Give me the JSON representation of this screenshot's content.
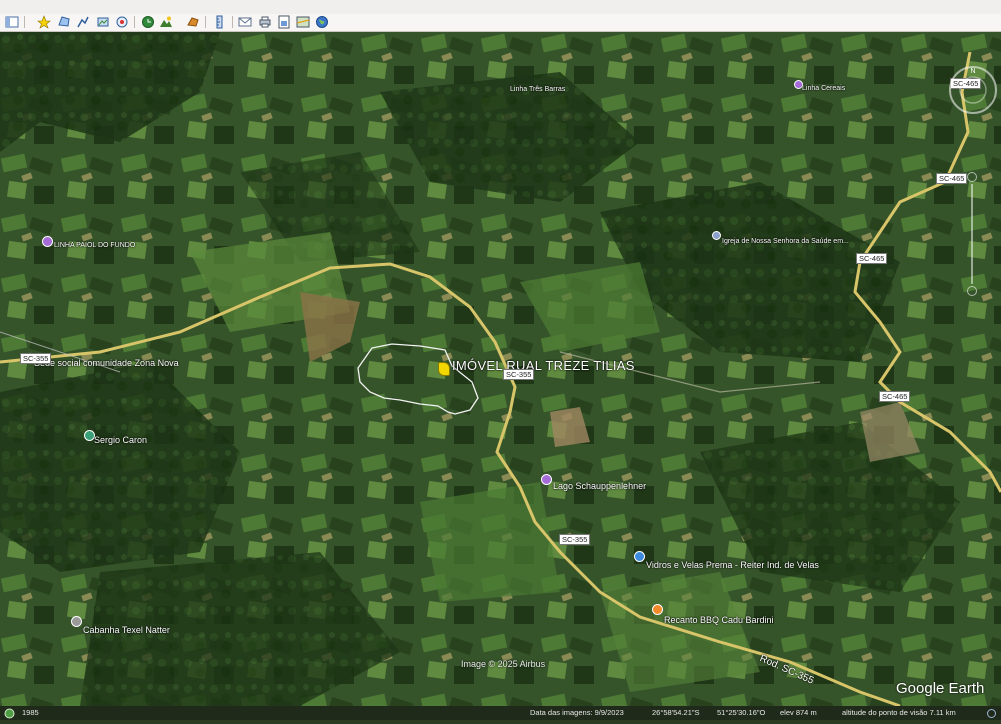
{
  "toolbar": {
    "buttons": [
      {
        "name": "sidebar-toggle-button",
        "icon": "sidebar-icon"
      },
      {
        "name": "add-placemark-button",
        "icon": "placemark-icon"
      },
      {
        "name": "add-polygon-button",
        "icon": "polygon-icon"
      },
      {
        "name": "add-path-button",
        "icon": "path-icon"
      },
      {
        "name": "add-overlay-button",
        "icon": "overlay-icon"
      },
      {
        "name": "record-tour-button",
        "icon": "tour-icon"
      },
      {
        "name": "historical-imagery-button",
        "icon": "clock-icon"
      },
      {
        "name": "sunlight-button",
        "icon": "sun-icon"
      },
      {
        "name": "switch-planets-button",
        "icon": "planet-icon"
      },
      {
        "name": "ruler-button",
        "icon": "ruler-icon"
      },
      {
        "name": "email-button",
        "icon": "email-icon"
      },
      {
        "name": "print-button",
        "icon": "print-icon"
      },
      {
        "name": "save-image-button",
        "icon": "save-image-icon"
      },
      {
        "name": "view-in-maps-button",
        "icon": "map-icon"
      },
      {
        "name": "earth-web-button",
        "icon": "earth-icon"
      }
    ]
  },
  "map": {
    "property_label": "IMÓVEL RUAL TREZE TILIAS",
    "places": [
      {
        "key": "linha_tres_barras",
        "text": "Linha Três Barras"
      },
      {
        "key": "linha_cereais",
        "text": "Linha Cereais"
      },
      {
        "key": "linha_paiol",
        "text": "LINHA PAIOL DO FUNDO"
      },
      {
        "key": "igreja",
        "text": "Igreja de Nossa Senhora da Saúde em..."
      },
      {
        "key": "sede",
        "text": "Sede social comunidade Zona Nova"
      },
      {
        "key": "sergio",
        "text": "Sergio Caron"
      },
      {
        "key": "lago",
        "text": "Lago Schauppenlehner"
      },
      {
        "key": "vidros",
        "text": "Vidros e Velas Prema - Reiter Ind. de Velas"
      },
      {
        "key": "recanto",
        "text": "Recanto BBQ Cadu Bardini"
      },
      {
        "key": "cabanha",
        "text": "Cabanha Texel Natter"
      }
    ],
    "roads": {
      "sc465_a": "SC-465",
      "sc465_b": "SC-465",
      "sc465_c": "SC-465",
      "sc465_d": "SC-465",
      "sc355_a": "SC-355",
      "sc355_b": "SC-355",
      "sc355_c": "SC-355",
      "rod": "Rod. SC-355"
    },
    "image_credit": "Image © 2025 Airbus",
    "logo": "Google Earth"
  },
  "status": {
    "year": "1985",
    "imagery_date": "Data das imagens: 9/9/2023",
    "lat": "26°58'54.21\"S",
    "lon": "51°25'30.16\"O",
    "elev": "elev  874 m",
    "eye_alt": "altitude do ponto de visão   7.11 km"
  },
  "colors": {
    "map_base": "#2f4a23",
    "road": "#d8c56a",
    "boundary": "#f2f2f2",
    "pin_yellow": "#f2d800"
  }
}
